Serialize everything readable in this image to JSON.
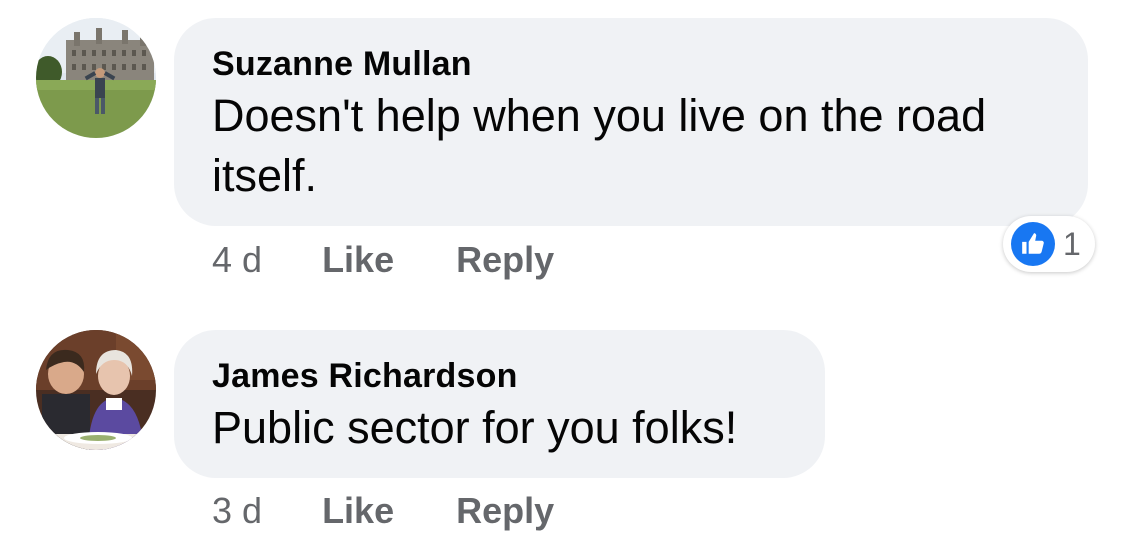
{
  "comments": [
    {
      "author": "Suzanne Mullan",
      "text": "Doesn't help when you live on the road itself.",
      "time": "4 d",
      "like_label": "Like",
      "reply_label": "Reply",
      "avatar_icon": "profile-photo-castle",
      "reactions": {
        "icon": "thumbs-up-icon",
        "count": "1",
        "color": "#1877f2"
      }
    },
    {
      "author": "James Richardson",
      "text": "Public sector for you folks!",
      "time": "3 d",
      "like_label": "Like",
      "reply_label": "Reply",
      "avatar_icon": "profile-photo-two-people"
    }
  ],
  "colors": {
    "bubble": "#f0f2f5",
    "meta_text": "#65676b",
    "main_text": "#050505"
  }
}
